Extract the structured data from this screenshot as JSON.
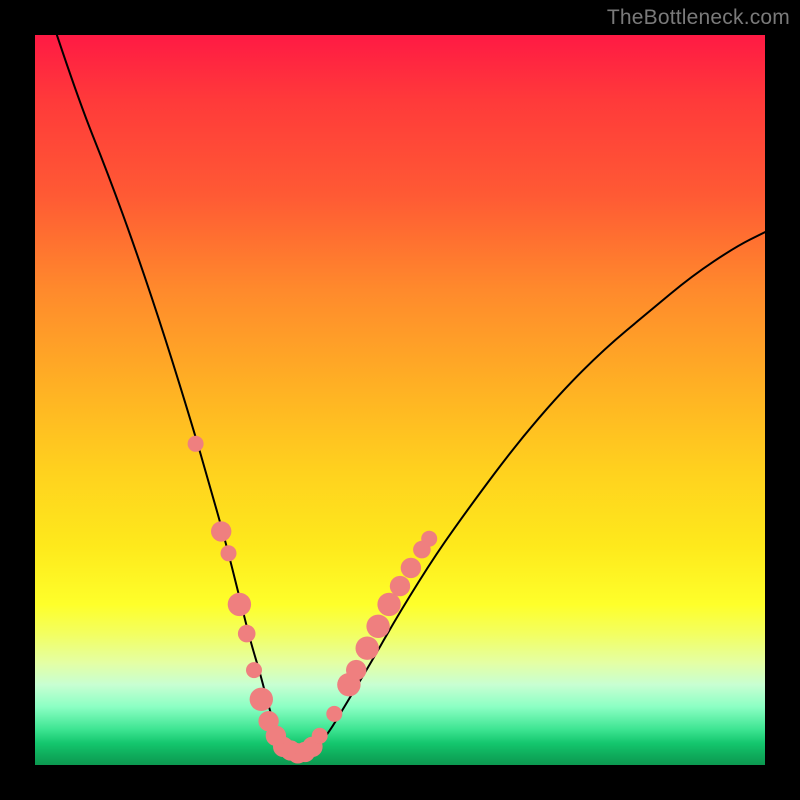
{
  "watermark": "TheBottleneck.com",
  "chart_data": {
    "type": "line",
    "title": "",
    "xlabel": "",
    "ylabel": "",
    "xlim": [
      0,
      100
    ],
    "ylim": [
      0,
      100
    ],
    "grid": false,
    "legend": false,
    "series": [
      {
        "name": "bottleneck-curve",
        "color": "#000000",
        "x": [
          3,
          6,
          10,
          14,
          18,
          22,
          24,
          26,
          28,
          29.5,
          31,
          32,
          33,
          34,
          35,
          36.5,
          38,
          40,
          43,
          46,
          50,
          55,
          60,
          66,
          72,
          78,
          84,
          90,
          96,
          100
        ],
        "y": [
          100,
          91,
          81,
          70,
          58,
          45,
          38,
          31,
          23,
          17,
          12,
          8,
          5,
          3,
          2,
          1.5,
          2,
          4,
          9,
          14,
          21,
          29,
          36,
          44,
          51,
          57,
          62,
          67,
          71,
          73
        ]
      },
      {
        "name": "marker-dots",
        "color": "#ef7f7f",
        "type": "scatter",
        "points": [
          {
            "x": 22,
            "y": 44,
            "r": 1.1
          },
          {
            "x": 25.5,
            "y": 32,
            "r": 1.4
          },
          {
            "x": 26.5,
            "y": 29,
            "r": 1.1
          },
          {
            "x": 28,
            "y": 22,
            "r": 1.6
          },
          {
            "x": 29,
            "y": 18,
            "r": 1.2
          },
          {
            "x": 30,
            "y": 13,
            "r": 1.1
          },
          {
            "x": 31,
            "y": 9,
            "r": 1.6
          },
          {
            "x": 32,
            "y": 6,
            "r": 1.4
          },
          {
            "x": 33,
            "y": 4,
            "r": 1.4
          },
          {
            "x": 34,
            "y": 2.5,
            "r": 1.4
          },
          {
            "x": 35,
            "y": 2,
            "r": 1.4
          },
          {
            "x": 36,
            "y": 1.6,
            "r": 1.4
          },
          {
            "x": 37,
            "y": 1.8,
            "r": 1.4
          },
          {
            "x": 38,
            "y": 2.5,
            "r": 1.4
          },
          {
            "x": 39,
            "y": 4,
            "r": 1.1
          },
          {
            "x": 41,
            "y": 7,
            "r": 1.1
          },
          {
            "x": 43,
            "y": 11,
            "r": 1.6
          },
          {
            "x": 44,
            "y": 13,
            "r": 1.4
          },
          {
            "x": 45.5,
            "y": 16,
            "r": 1.6
          },
          {
            "x": 47,
            "y": 19,
            "r": 1.6
          },
          {
            "x": 48.5,
            "y": 22,
            "r": 1.6
          },
          {
            "x": 50,
            "y": 24.5,
            "r": 1.4
          },
          {
            "x": 51.5,
            "y": 27,
            "r": 1.4
          },
          {
            "x": 53,
            "y": 29.5,
            "r": 1.2
          },
          {
            "x": 54,
            "y": 31,
            "r": 1.1
          }
        ]
      }
    ],
    "background_gradient": {
      "top_color": "#ff1a44",
      "bottom_color": "#0c9850",
      "description": "vertical red-to-green via orange/yellow"
    }
  }
}
